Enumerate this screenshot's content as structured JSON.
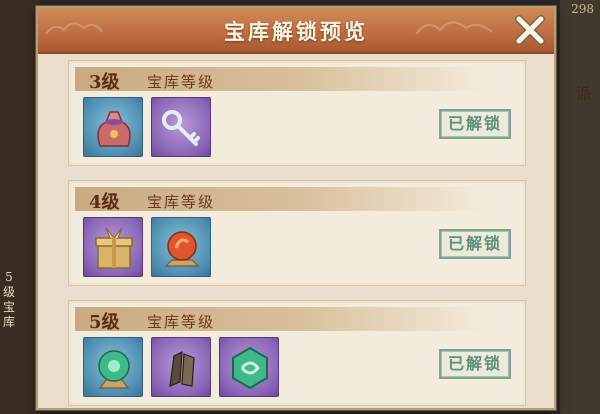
{
  "title": "宝库解锁预览",
  "background": {
    "right_text": "派",
    "top_right_number": "298",
    "left_text": "5级宝库"
  },
  "levels": [
    {
      "level": "3级",
      "label": "宝库等级",
      "status": "已解锁",
      "items": [
        {
          "icon": "pouch-icon",
          "frame": "blue"
        },
        {
          "icon": "key-icon",
          "frame": "purple"
        }
      ]
    },
    {
      "level": "4级",
      "label": "宝库等级",
      "status": "已解锁",
      "items": [
        {
          "icon": "gift-box-icon",
          "frame": "purple"
        },
        {
          "icon": "fire-orb-icon",
          "frame": "blue"
        }
      ]
    },
    {
      "level": "5级",
      "label": "宝库等级",
      "status": "已解锁",
      "items": [
        {
          "icon": "jade-orb-icon",
          "frame": "blue"
        },
        {
          "icon": "ore-shards-icon",
          "frame": "purple"
        },
        {
          "icon": "jade-token-icon",
          "frame": "purple"
        }
      ]
    }
  ],
  "colors": {
    "header": "#bf6f43",
    "panel": "#e9dfcc",
    "card": "#f3ebdb",
    "stamp": "#5e8f77",
    "frame_blue": "#4f8fb2",
    "frame_purple": "#8a66b8"
  }
}
